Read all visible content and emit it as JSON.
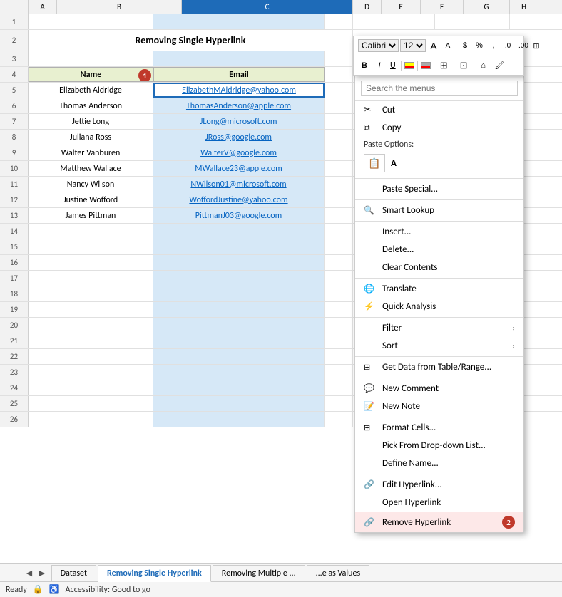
{
  "title": "Removing Single Hyperlink",
  "spreadsheet": {
    "title_row": "Removing Single Hyperlink",
    "col_headers": [
      "",
      "A",
      "B",
      "C",
      "D",
      "E",
      "F",
      "G",
      "H"
    ],
    "headers": {
      "name": "Name",
      "email": "Email"
    },
    "rows": [
      {
        "row": "5",
        "name": "Elizabeth Aldridge",
        "email": "ElizabethMAldridge@yahoo.com"
      },
      {
        "row": "6",
        "name": "Thomas Anderson",
        "email": "ThomasAnderson@apple.com"
      },
      {
        "row": "7",
        "name": "Jettie Long",
        "email": "JLong@microsoft.com"
      },
      {
        "row": "8",
        "name": "Juliana Ross",
        "email": "JRoss@google.com"
      },
      {
        "row": "9",
        "name": "Walter Vanburen",
        "email": "WalterV@google.com"
      },
      {
        "row": "10",
        "name": "Matthew Wallace",
        "email": "MWallace23@apple.com"
      },
      {
        "row": "11",
        "name": "Nancy Wilson",
        "email": "NWilson01@microsoft.com"
      },
      {
        "row": "12",
        "name": "Justine Wofford",
        "email": "WoffordJustine@yahoo.com"
      },
      {
        "row": "13",
        "name": "James Pittman",
        "email": "PittmanJ03@google.com"
      }
    ],
    "empty_rows": [
      "14",
      "15",
      "16",
      "17",
      "18",
      "19",
      "20",
      "21",
      "22",
      "23",
      "24",
      "25",
      "26"
    ]
  },
  "mini_toolbar": {
    "font": "Calibri",
    "size": "12",
    "bold": "B",
    "italic": "I",
    "underline": "U",
    "percent": "%",
    "dollar": "$",
    "comma": ",",
    "increase_decimal": ".0",
    "decrease_decimal": ".00",
    "format_as_table": "⊞"
  },
  "context_menu": {
    "search_placeholder": "Search the menus",
    "items": [
      {
        "id": "cut",
        "label": "Cut",
        "icon": "✂",
        "has_arrow": false
      },
      {
        "id": "copy",
        "label": "Copy",
        "icon": "⧉",
        "has_arrow": false
      },
      {
        "id": "paste_options_label",
        "label": "Paste Options:",
        "icon": "",
        "is_label": true
      },
      {
        "id": "paste_special",
        "label": "Paste Special...",
        "icon": "",
        "has_arrow": false
      },
      {
        "id": "smart_lookup",
        "label": "Smart Lookup",
        "icon": "🔍",
        "has_arrow": false
      },
      {
        "id": "insert",
        "label": "Insert...",
        "icon": "",
        "has_arrow": false
      },
      {
        "id": "delete",
        "label": "Delete...",
        "icon": "",
        "has_arrow": false
      },
      {
        "id": "clear_contents",
        "label": "Clear Contents",
        "icon": "",
        "has_arrow": false
      },
      {
        "id": "translate",
        "label": "Translate",
        "icon": "🌐",
        "has_arrow": false
      },
      {
        "id": "quick_analysis",
        "label": "Quick Analysis",
        "icon": "⚡",
        "has_arrow": false
      },
      {
        "id": "filter",
        "label": "Filter",
        "icon": "",
        "has_arrow": true
      },
      {
        "id": "sort",
        "label": "Sort",
        "icon": "",
        "has_arrow": true
      },
      {
        "id": "get_data",
        "label": "Get Data from Table/Range...",
        "icon": "⊞",
        "has_arrow": false
      },
      {
        "id": "new_comment",
        "label": "New Comment",
        "icon": "💬",
        "has_arrow": false
      },
      {
        "id": "new_note",
        "label": "New Note",
        "icon": "📝",
        "has_arrow": false
      },
      {
        "id": "format_cells",
        "label": "Format Cells...",
        "icon": "⊞",
        "has_arrow": false
      },
      {
        "id": "pick_dropdown",
        "label": "Pick From Drop-down List...",
        "icon": "",
        "has_arrow": false
      },
      {
        "id": "define_name",
        "label": "Define Name...",
        "icon": "",
        "has_arrow": false
      },
      {
        "id": "edit_hyperlink",
        "label": "Edit Hyperlink...",
        "icon": "🔗",
        "has_arrow": false
      },
      {
        "id": "open_hyperlink",
        "label": "Open Hyperlink",
        "icon": "",
        "has_arrow": false
      },
      {
        "id": "remove_hyperlink",
        "label": "Remove Hyperlink",
        "icon": "🔗",
        "has_arrow": false,
        "is_highlighted": true
      }
    ],
    "paste_icon": "📋"
  },
  "sheet_tabs": [
    {
      "id": "dataset",
      "label": "Dataset",
      "active": false
    },
    {
      "id": "removing_single",
      "label": "Removing Single Hyperlink",
      "active": true
    },
    {
      "id": "removing_multiple",
      "label": "Removing Multiple ...",
      "active": false
    },
    {
      "id": "paste_as_values",
      "label": "...e as Values",
      "active": false
    }
  ],
  "status_bar": {
    "ready": "Ready",
    "accessibility": "Accessibility: Good to go"
  },
  "badges": {
    "badge1": "1",
    "badge2": "2"
  }
}
